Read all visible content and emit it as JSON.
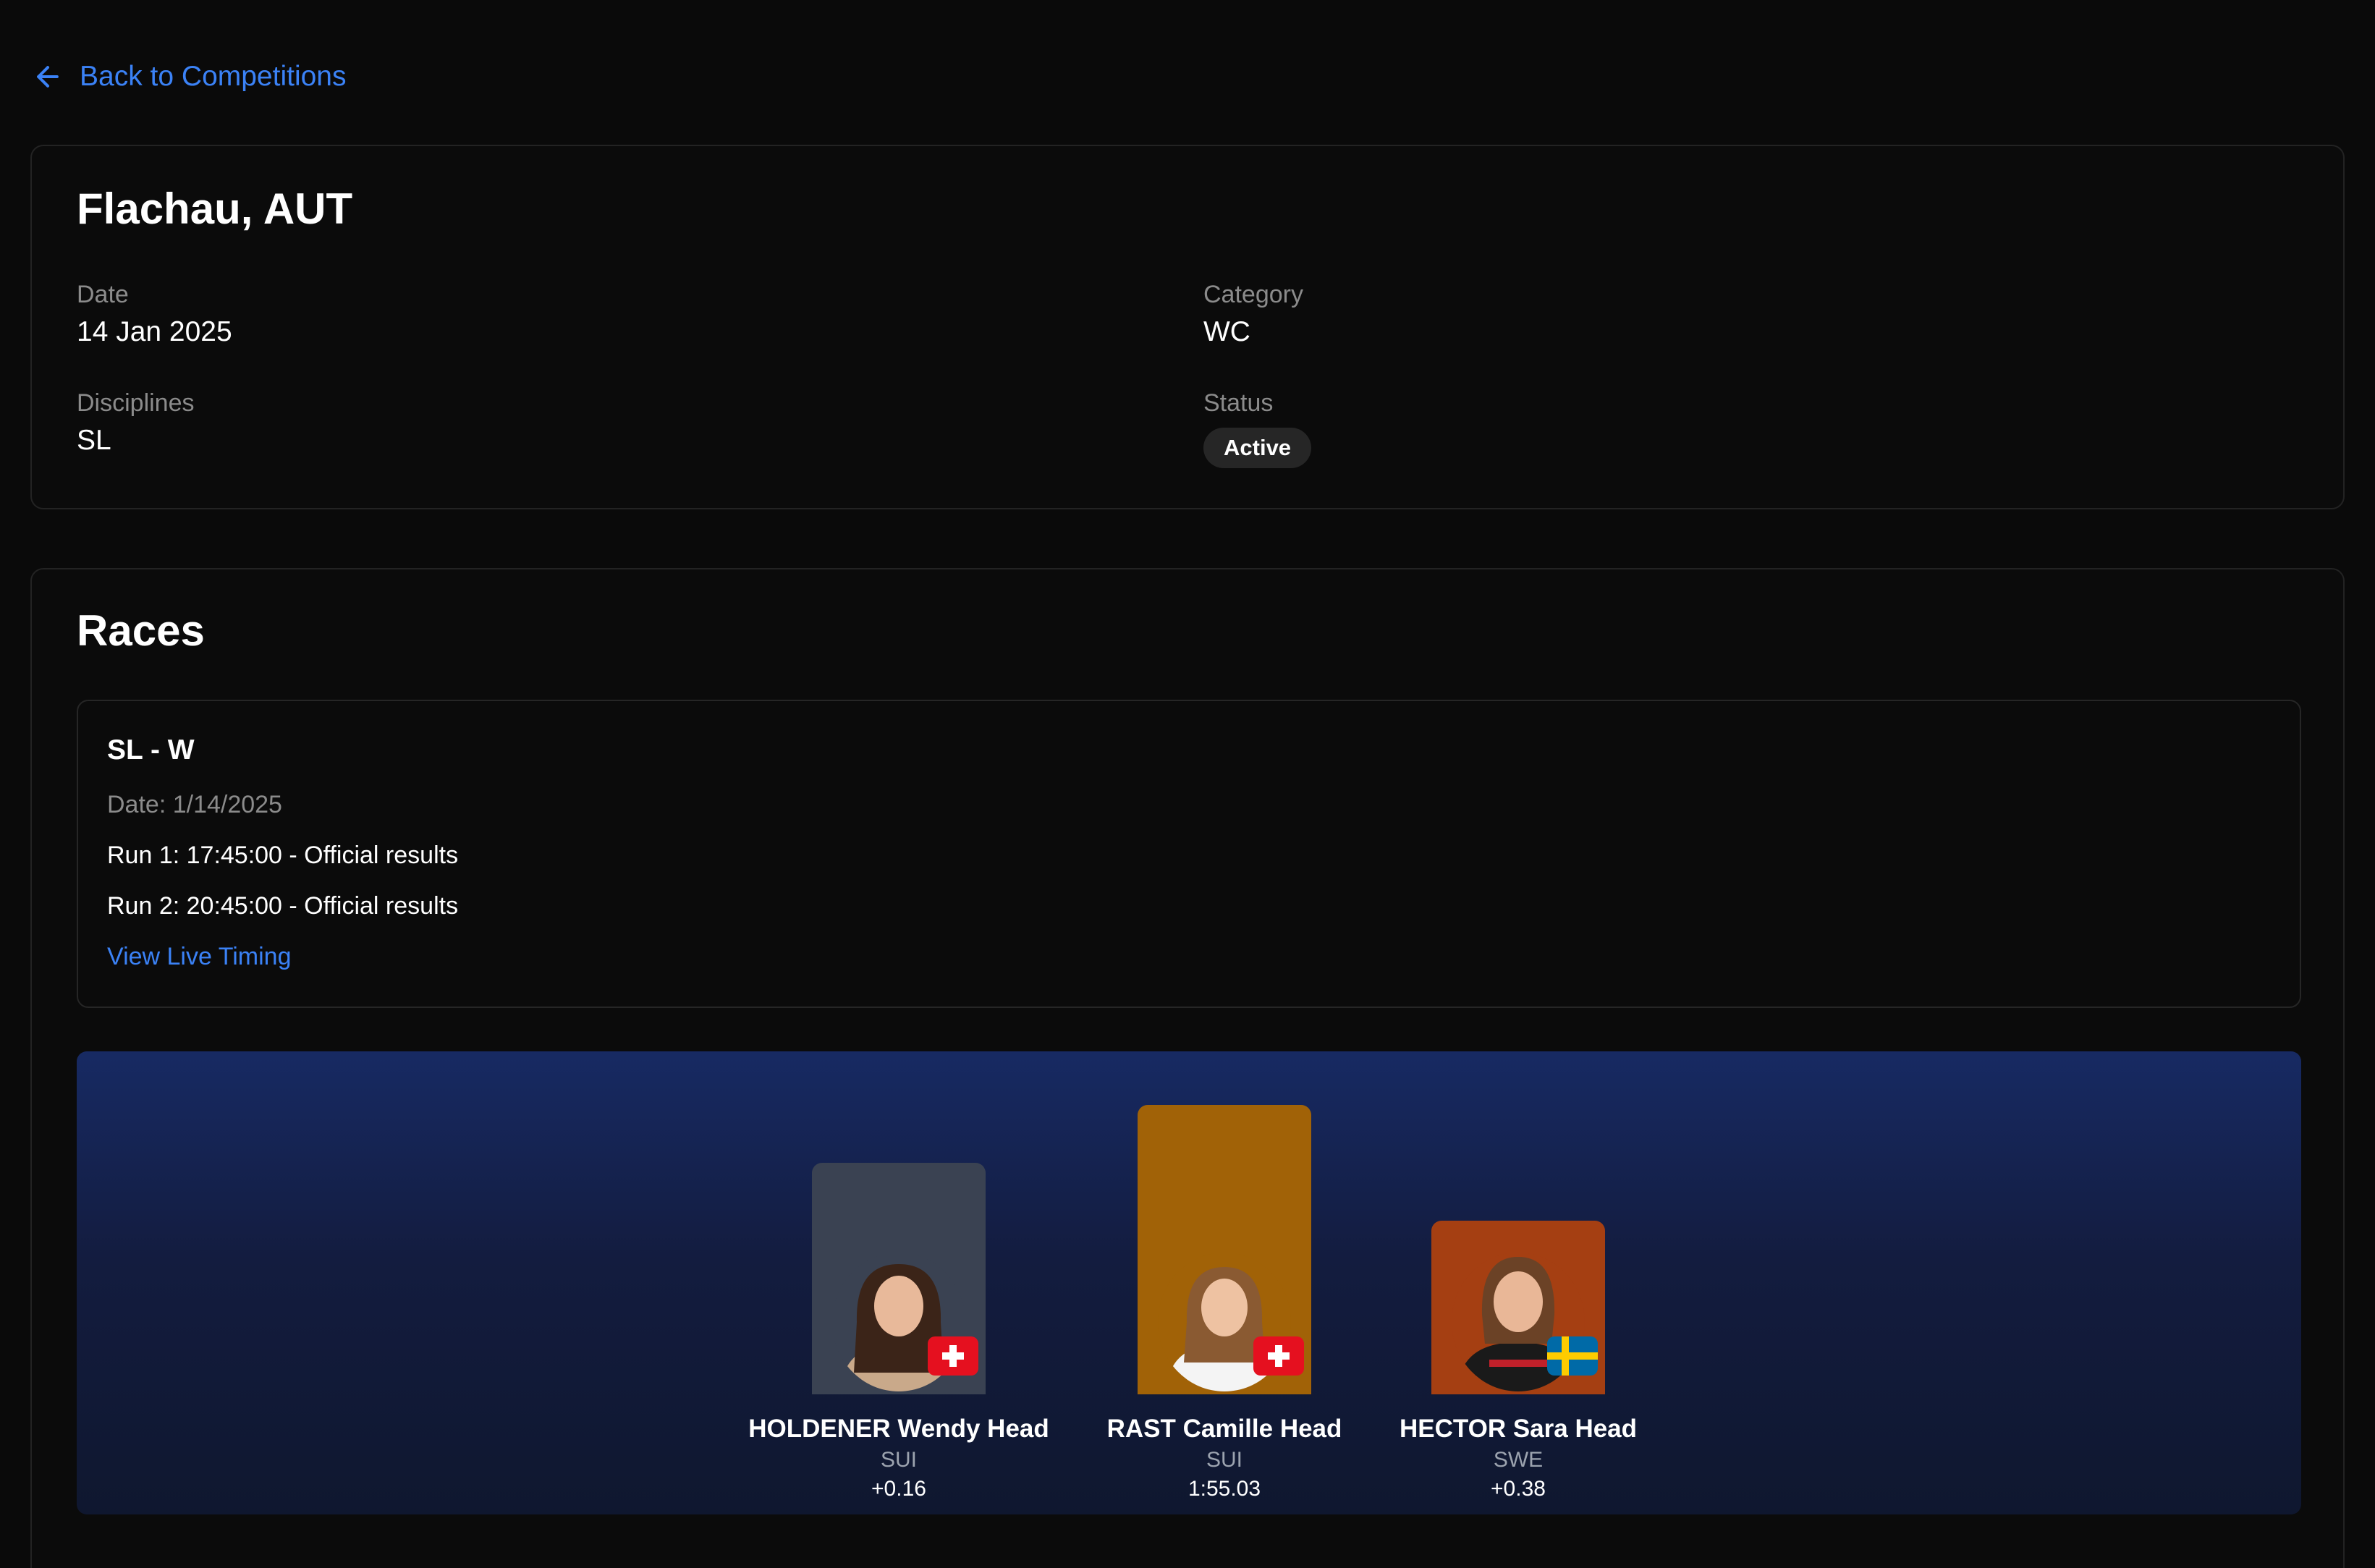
{
  "nav": {
    "back_label": "Back to Competitions"
  },
  "competition": {
    "title": "Flachau, AUT",
    "date_label": "Date",
    "date_value": "14 Jan 2025",
    "category_label": "Category",
    "category_value": "WC",
    "disciplines_label": "Disciplines",
    "disciplines_value": "SL",
    "status_label": "Status",
    "status_value": "Active"
  },
  "races": {
    "title": "Races",
    "items": [
      {
        "name": "SL - W",
        "date": "Date: 1/14/2025",
        "run1": "Run 1: 17:45:00 - Official results",
        "run2": "Run 2: 20:45:00 - Official results",
        "live_link": "View Live Timing"
      }
    ]
  },
  "podium": {
    "second": {
      "name": "HOLDENER Wendy Head",
      "country": "SUI",
      "time": "+0.16",
      "bg": "#3a4252",
      "flag": "switzerland-flag-icon"
    },
    "first": {
      "name": "RAST Camille Head",
      "country": "SUI",
      "time": "1:55.03",
      "bg": "#a16207",
      "flag": "switzerland-flag-icon"
    },
    "third": {
      "name": "HECTOR Sara Head",
      "country": "SWE",
      "time": "+0.38",
      "bg": "#a53f12",
      "flag": "sweden-flag-icon"
    }
  },
  "colors": {
    "accent": "#3b82f6",
    "background": "#0a0a0a",
    "muted": "#8b8b8b"
  }
}
